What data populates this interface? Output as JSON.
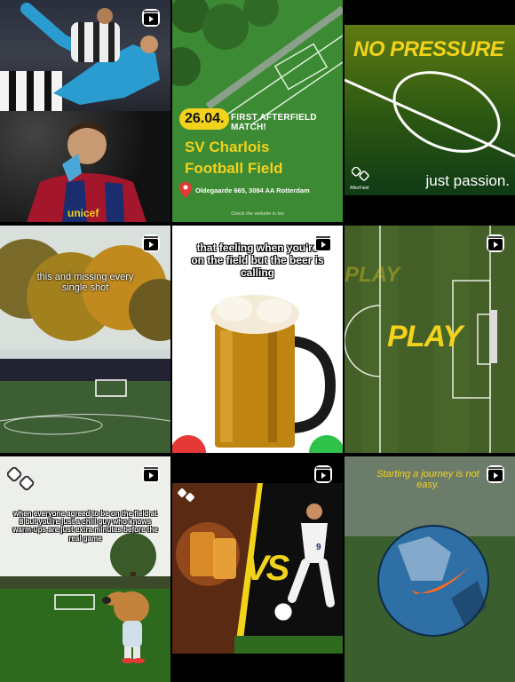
{
  "colors": {
    "accent_yellow": "#f2d21b",
    "grass_green": "#3d7a2e",
    "dark_green": "#1d3a14",
    "barca_red": "#a3162b",
    "barca_blue": "#1a2d6e"
  },
  "posts": [
    {
      "id": "bicycle-kick",
      "icon": "reels-icon"
    },
    {
      "id": "messi",
      "shirt_text": "unicef"
    },
    {
      "id": "first-match",
      "date": "26.04.",
      "headline": "FIRST AFTERFIELD MATCH!",
      "title_line1": "SV Charlois",
      "title_line2": "Football Field",
      "address": "Oldegaarde 665, 3084 AA Rotterdam",
      "footer": "Check the website in bio",
      "icon": "location-pin-icon"
    },
    {
      "id": "no-pressure",
      "title": "NO PRESSURE",
      "tagline": "just passion.",
      "brand": "AfterField"
    },
    {
      "id": "missing-shots",
      "caption": "this and missing every single shot",
      "icon": "reels-icon"
    },
    {
      "id": "beer",
      "caption": "that feeling when you're on the field but the beer is calling",
      "icon": "reels-icon"
    },
    {
      "id": "play",
      "word": "PLAY",
      "faded_word": "PLAY",
      "icon": "reels-icon"
    },
    {
      "id": "warmups",
      "caption": "when everyone agreed to be on the field at 8 but you're just a chill guy who knows warm-ups are just extra minutes before the real game",
      "icon": "reels-icon"
    },
    {
      "id": "versus",
      "vs": "VS",
      "jersey_number": "9",
      "icon": "reels-icon"
    },
    {
      "id": "journey",
      "caption": "Starting a journey is not easy.",
      "icon": "reels-icon"
    }
  ]
}
